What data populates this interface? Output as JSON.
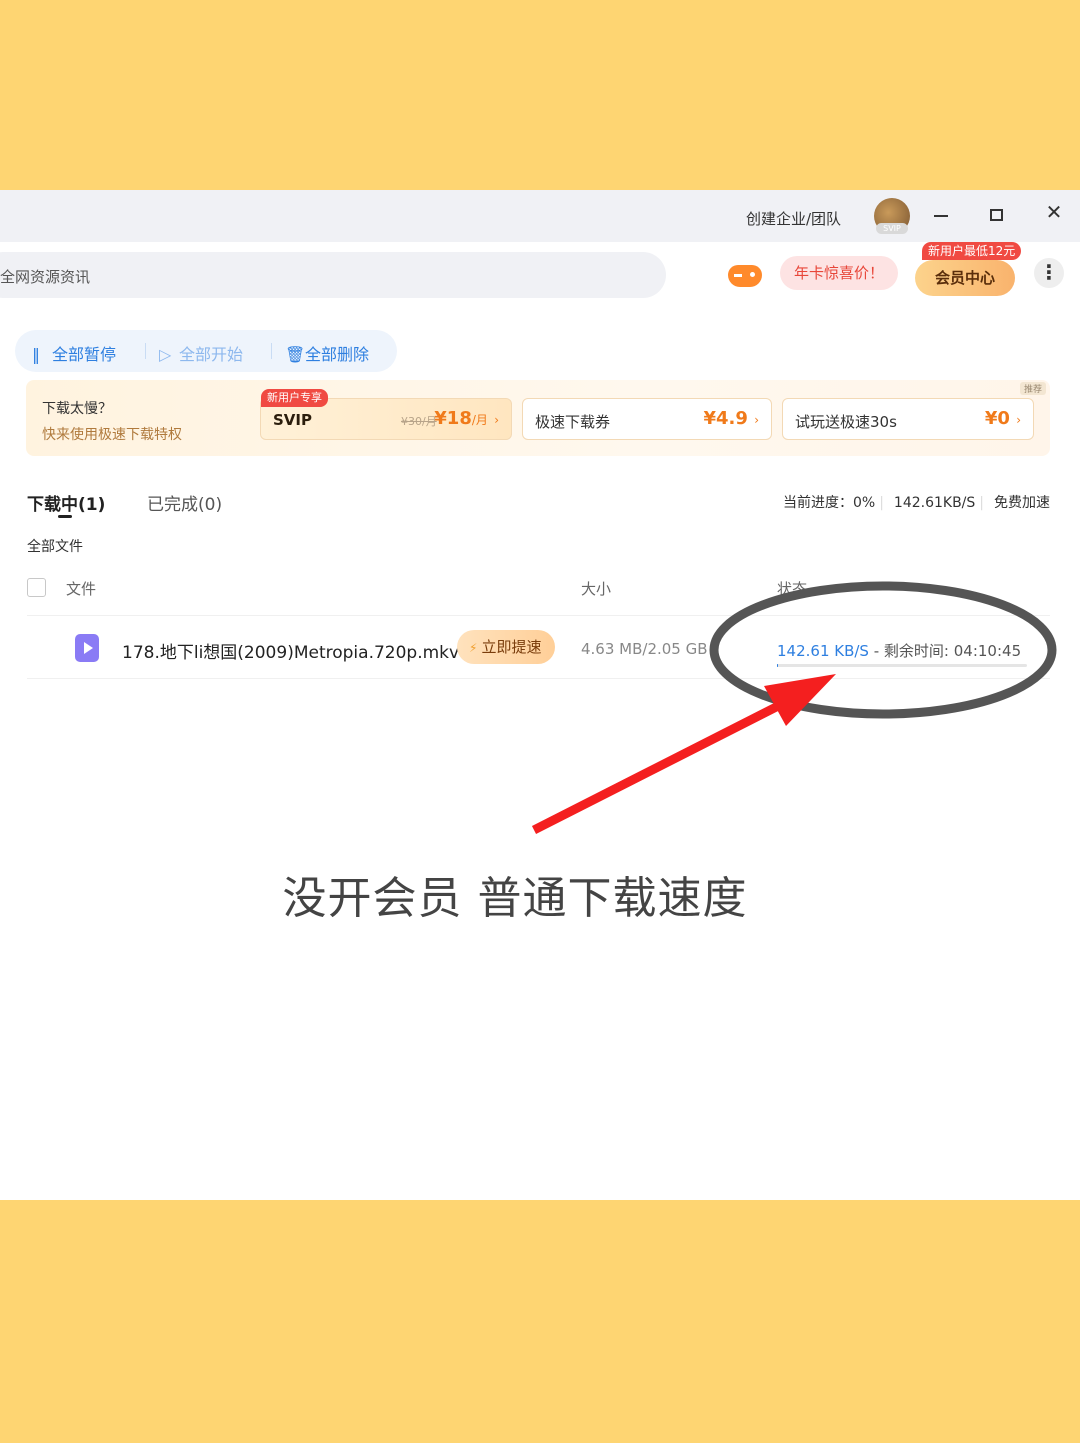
{
  "titlebar": {
    "create_team": "创建企业/团队",
    "svip_tag": "SVIP",
    "close_glyph": "✕"
  },
  "header": {
    "search_placeholder": "全网资源资讯",
    "annual_card_promo": "年卡惊喜价！",
    "vip_center": "会员中心",
    "vip_badge": "新用户最低12元",
    "more_glyph": "⋮"
  },
  "toolbar": {
    "pause_all": "全部暂停",
    "start_all": "全部开始",
    "delete_all": "全部删除",
    "pause_glyph": "‖",
    "start_glyph": "▷",
    "delete_glyph": "🗑"
  },
  "banner": {
    "title": "下载太慢？",
    "subtitle": "快来使用极速下载特权",
    "recommend": "推荐",
    "offers": [
      {
        "tag": "新用户专享",
        "name": "SVIP",
        "old_price": "¥30/月",
        "price": "¥18",
        "unit": "/月",
        "arrow": "›"
      },
      {
        "name": "极速下载券",
        "price": "¥4.9",
        "arrow": "›"
      },
      {
        "name": "试玩送极速30s",
        "price": "¥0",
        "arrow": "›"
      }
    ]
  },
  "tabs": {
    "downloading": "下载中(1)",
    "completed": "已完成(0)"
  },
  "progress_info": {
    "current": "当前进度：0%",
    "speed": "142.61KB/S",
    "free_boost": "免费加速"
  },
  "filter": {
    "all_files": "全部文件"
  },
  "table": {
    "headers": {
      "file": "文件",
      "size": "大小",
      "status": "状态"
    },
    "rows": [
      {
        "name": "178.地下li想国(2009)Metropia.720p.mkv",
        "boost": "立即提速",
        "size": "4.63 MB/2.05 GB",
        "speed": "142.61 KB/S",
        "remaining": " - 剩余时间: 04:10:45",
        "progress_percent": 0.2
      }
    ]
  },
  "annotation": {
    "caption": "没开会员 普通下载速度",
    "arrow_color": "#f41f1f",
    "circle_color": "#555555"
  },
  "colors": {
    "background": "#fed572",
    "accent": "#2e7fe0"
  }
}
